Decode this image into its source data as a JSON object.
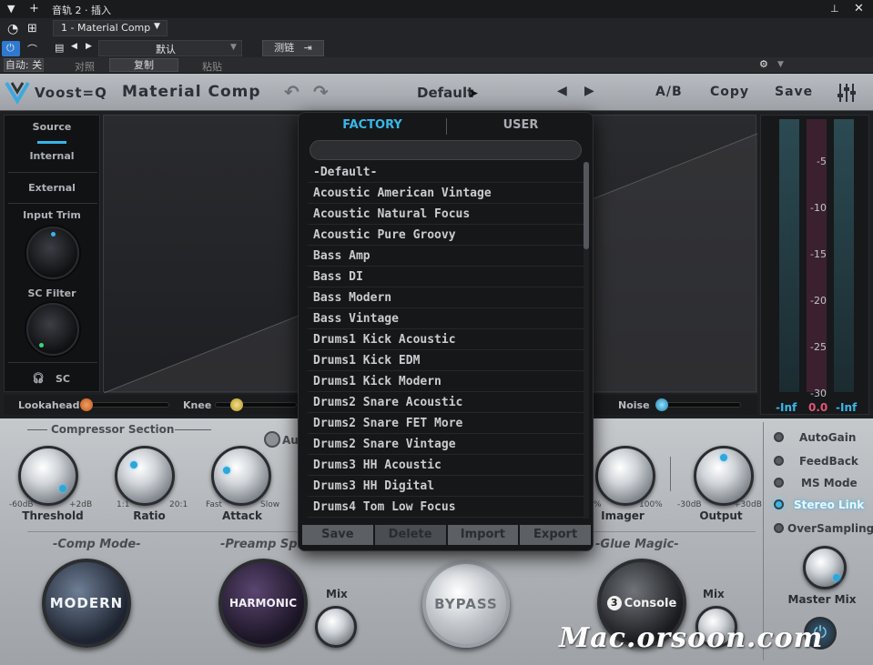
{
  "host": {
    "window_title": "音轨 2 · 插入",
    "insert_name": "1 - Material Comp",
    "preset_name": "默认",
    "sidechain_label": "测链",
    "auto_label": "自动: 关",
    "compare_label": "对照",
    "copy_label": "复制",
    "paste_label": "粘贴"
  },
  "plugin": {
    "brand": "Voost=Q",
    "product": "Material Comp",
    "current_preset": "Default",
    "ab_label": "A/B",
    "copy_label": "Copy",
    "save_label": "Save"
  },
  "left_panel": {
    "source_label": "Source",
    "internal_label": "Internal",
    "external_label": "External",
    "input_trim_label": "Input Trim",
    "sc_filter_label": "SC Filter",
    "sc_label": "SC"
  },
  "sliders": {
    "lookahead_label": "Lookahead",
    "knee_label": "Knee",
    "noise_label": "Noise"
  },
  "meters": {
    "scale": [
      "-5",
      "-10",
      "-15",
      "-20",
      "-25",
      "-30"
    ],
    "readout_left": "-Inf",
    "readout_mid": "0.0",
    "readout_right": "-Inf"
  },
  "compressor": {
    "section_title": "Compressor Section",
    "auto_label": "Au",
    "threshold": {
      "label": "Threshold",
      "min": "-60dB",
      "max": "+2dB"
    },
    "ratio": {
      "label": "Ratio",
      "min": "1:1",
      "max": "20:1"
    },
    "attack": {
      "label": "Attack",
      "min": "Fast",
      "max": "Slow"
    },
    "imager": {
      "label": "Imager",
      "min": "%",
      "max": "100%"
    },
    "output": {
      "label": "Output",
      "min": "-30dB",
      "max": "+30dB"
    }
  },
  "options": {
    "autogain": "AutoGain",
    "feedback": "FeedBack",
    "ms_mode": "MS Mode",
    "stereo_link": "Stereo Link",
    "oversampling": "OverSampling",
    "master_mix": "Master Mix"
  },
  "modes": {
    "comp_mode_title": "-Comp Mode-",
    "comp_mode_value": "MODERN",
    "preamp_title": "-Preamp Spi",
    "preamp_value": "HARMONIC",
    "bypass_label": "BYPASS",
    "glue_title": "-Glue Magic-",
    "glue_value": "Console",
    "glue_num": "3",
    "mix_label": "Mix",
    "mix_label2": "Mix"
  },
  "preset_popup": {
    "tab_factory": "FACTORY",
    "tab_user": "USER",
    "search_value": "",
    "items": [
      "-Default-",
      "Acoustic American Vintage",
      "Acoustic Natural Focus",
      "Acoustic Pure Groovy",
      "Bass Amp",
      "Bass DI",
      "Bass Modern",
      "Bass Vintage",
      "Drums1 Kick Acoustic",
      "Drums1 Kick EDM",
      "Drums1 Kick Modern",
      "Drums2 Snare Acoustic",
      "Drums2 Snare FET More",
      "Drums2 Snare Vintage",
      "Drums3 HH Acoustic",
      "Drums3 HH Digital",
      "Drums4 Tom Low Focus"
    ],
    "foot_save": "Save",
    "foot_delete": "Delete",
    "foot_import": "Import",
    "foot_export": "Export"
  },
  "watermark": "Mac.orsoon.com",
  "colors": {
    "accent": "#37b7e8",
    "panel": "#b3b6ba"
  }
}
